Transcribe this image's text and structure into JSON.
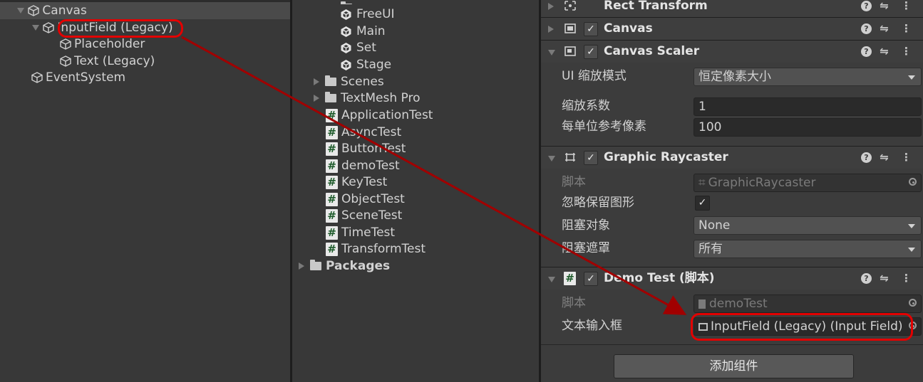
{
  "hierarchy": {
    "items": [
      {
        "label": "Canvas",
        "expanded": true
      },
      {
        "label": "InputField (Legacy)",
        "expanded": true
      },
      {
        "label": "Placeholder"
      },
      {
        "label": "Text (Legacy)"
      },
      {
        "label": "EventSystem"
      }
    ]
  },
  "project": {
    "items": [
      {
        "label": "FreeUI"
      },
      {
        "label": "Main"
      },
      {
        "label": "Set"
      },
      {
        "label": "Stage"
      },
      {
        "label": "Scenes"
      },
      {
        "label": "TextMesh Pro"
      },
      {
        "label": "ApplicationTest"
      },
      {
        "label": "AsyncTest"
      },
      {
        "label": "ButtonTest"
      },
      {
        "label": "demoTest"
      },
      {
        "label": "KeyTest"
      },
      {
        "label": "ObjectTest"
      },
      {
        "label": "SceneTest"
      },
      {
        "label": "TimeTest"
      },
      {
        "label": "TransformTest"
      },
      {
        "label": "Packages"
      }
    ]
  },
  "inspector": {
    "components": {
      "rect_transform": "Rect Transform",
      "canvas": "Canvas",
      "canvas_scaler": "Canvas Scaler",
      "graphic_raycaster": "Graphic Raycaster",
      "demo_test": "Demo Test",
      "demo_test_suffix": "(脚本)"
    },
    "canvas_scaler": {
      "ui_scale_mode_label": "UI 缩放模式",
      "ui_scale_mode_value": "恒定像素大小",
      "scale_factor_label": "缩放系数",
      "scale_factor_value": "1",
      "ref_ppu_label": "每单位参考像素",
      "ref_ppu_value": "100"
    },
    "graphic_raycaster": {
      "script_label": "脚本",
      "script_value": "GraphicRaycaster",
      "ignore_reversed_label": "忽略保留图形",
      "blocking_objects_label": "阻塞对象",
      "blocking_objects_value": "None",
      "blocking_mask_label": "阻塞遮罩",
      "blocking_mask_value": "所有"
    },
    "demo_test": {
      "script_label": "脚本",
      "script_value": "demoTest",
      "input_label": "文本输入框",
      "input_value": "InputField (Legacy) (Input Field)"
    },
    "add_component_label": "添加组件"
  },
  "colors": {
    "annotation_red": "#e30000",
    "arrow_red": "#a10000"
  }
}
